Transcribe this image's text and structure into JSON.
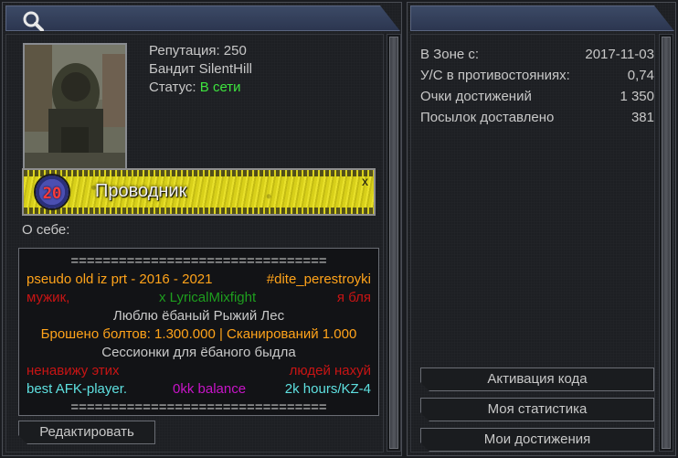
{
  "profile": {
    "reputation": "Репутация: 250",
    "name": "Бандит SilentHill",
    "status_label": "Статус:",
    "status_value": "В сети",
    "status_color": "#3ee43e"
  },
  "rank": {
    "level": "20",
    "title": "Проводник",
    "close": "x"
  },
  "about": {
    "label": "О себе:",
    "separator": "================================",
    "line1_left": "pseudo old iz prt - 2016 - 2021",
    "line1_right": "#dite_perestroyki",
    "line2_left": "мужик,",
    "line2_mid": "x LyricalMixfight",
    "line2_right": "я бля",
    "line3": "Люблю ёбаный Рыжий Лес",
    "line4": "Брошено болтов: 1.300.000 | Сканирований 1.000",
    "line5": "Сессионки для ёбаного быдла",
    "line6_left": "ненавижу этих",
    "line6_right": "людей нахуй",
    "line7_left": "best AFK-player.",
    "line7_mid": "0kk balance",
    "line7_right": "2k hours/KZ-4",
    "colors": {
      "orange": "#ffa31a",
      "red": "#c81414",
      "green": "#1e9e1e",
      "gray": "#c8c8c8",
      "cyan": "#5ee0e0",
      "purple": "#c814c8"
    }
  },
  "edit_label": "Редактировать",
  "stats": [
    {
      "label": "В Зоне с:",
      "value": "2017-11-03"
    },
    {
      "label": "У/С в противостояниях:",
      "value": "0,74"
    },
    {
      "label": "Очки достижений",
      "value": "1 350"
    },
    {
      "label": "Посылок доставлено",
      "value": "381"
    }
  ],
  "actions": {
    "activate": "Активация кода",
    "my_stats": "Моя статистика",
    "achievements": "Мои достижения"
  }
}
